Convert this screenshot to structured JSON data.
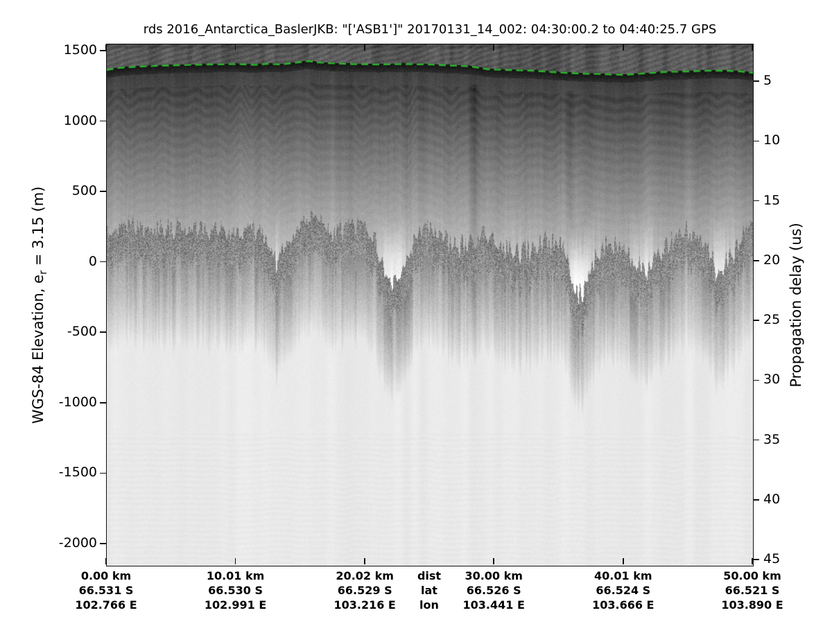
{
  "title": "rds 2016_Antarctica_BaslerJKB: \"['ASB1']\"  20170131_14_002: 04:30:00.2 to 04:40:25.7 GPS",
  "chart_data": {
    "type": "heatmap",
    "subtype": "radar-echogram",
    "colormap": "inverted-grayscale",
    "title": "rds 2016_Antarctica_BaslerJKB: \"['ASB1']\"  20170131_14_002: 04:30:00.2 to 04:40:25.7 GPS",
    "grid": false,
    "left_axis": {
      "label": "WGS-84 Elevation, e_r = 3.15 (m)",
      "label_main": "WGS-84 Elevation, e",
      "label_sub": "r",
      "label_tail": " = 3.15 (m)",
      "ticks": [
        1500,
        1000,
        500,
        0,
        -500,
        -1000,
        -1500,
        -2000
      ],
      "range": [
        1549,
        -2153
      ]
    },
    "right_axis": {
      "label": "Propagation delay (us)",
      "ticks": [
        5,
        10,
        15,
        20,
        25,
        30,
        35,
        40,
        45
      ],
      "range": [
        1.87,
        45.46
      ]
    },
    "x_axis": {
      "header": {
        "dist": "dist",
        "lat": "lat",
        "lon": "lon"
      },
      "range_km": [
        0,
        50
      ],
      "ticks": [
        {
          "km": 0.0,
          "dist": "0.00 km",
          "lat": "66.531 S",
          "lon": "102.766 E"
        },
        {
          "km": 10.01,
          "dist": "10.01 km",
          "lat": "66.530 S",
          "lon": "102.991 E"
        },
        {
          "km": 20.02,
          "dist": "20.02 km",
          "lat": "66.529 S",
          "lon": "103.216 E"
        },
        {
          "km": 30.0,
          "dist": "30.00 km",
          "lat": "66.526 S",
          "lon": "103.441 E"
        },
        {
          "km": 40.01,
          "dist": "40.01 km",
          "lat": "66.524 S",
          "lon": "103.666 E"
        },
        {
          "km": 50.0,
          "dist": "50.00 km",
          "lat": "66.521 S",
          "lon": "103.890 E"
        }
      ]
    },
    "surface_line": {
      "name": "picked ice surface",
      "color": "#2cb52c",
      "style": "dashed",
      "x_km": [
        0,
        1,
        2.5,
        4,
        6,
        8,
        10,
        11.5,
        12.5,
        13.5,
        14.8,
        15.6,
        16.3,
        17.5,
        19,
        21,
        23,
        25,
        26.5,
        28,
        29.5,
        31,
        33,
        34.5,
        36.5,
        38.5,
        40,
        41.5,
        43,
        45,
        46.5,
        48,
        49,
        50
      ],
      "elevation_m": [
        1367,
        1382,
        1391,
        1397,
        1402,
        1406,
        1409,
        1404,
        1411,
        1406,
        1421,
        1431,
        1421,
        1414,
        1409,
        1406,
        1409,
        1406,
        1399,
        1394,
        1372,
        1367,
        1362,
        1352,
        1342,
        1337,
        1332,
        1342,
        1352,
        1357,
        1362,
        1362,
        1357,
        1347
      ]
    },
    "bed_echo": {
      "name": "bed return (approx. top of rough echo)",
      "x_km": [
        0.1,
        1.45,
        2.8,
        4.4,
        6.0,
        7.9,
        9.5,
        10.8,
        11.9,
        12.7,
        13.25,
        13.8,
        14.6,
        15.9,
        17.3,
        18.6,
        19.7,
        20.8,
        21.8,
        22.7,
        23.6,
        24.6,
        25.9,
        27.2,
        28.4,
        29.3,
        30.5,
        31.8,
        33.0,
        34.2,
        35.4,
        36.2,
        36.7,
        37.4,
        38.4,
        39.4,
        40.5,
        41.7,
        42.8,
        44.0,
        45.3,
        46.4,
        47.3,
        48.2,
        49.1,
        50.0
      ],
      "elevation_m": [
        235,
        294,
        225,
        254,
        225,
        250,
        200,
        274,
        225,
        48,
        3,
        160,
        235,
        299,
        220,
        245,
        309,
        151,
        -184,
        -76,
        126,
        259,
        185,
        107,
        151,
        235,
        126,
        77,
        107,
        151,
        116,
        -184,
        -248,
        -61,
        126,
        136,
        52,
        -71,
        62,
        175,
        235,
        151,
        -120,
        28,
        175,
        225
      ]
    }
  }
}
